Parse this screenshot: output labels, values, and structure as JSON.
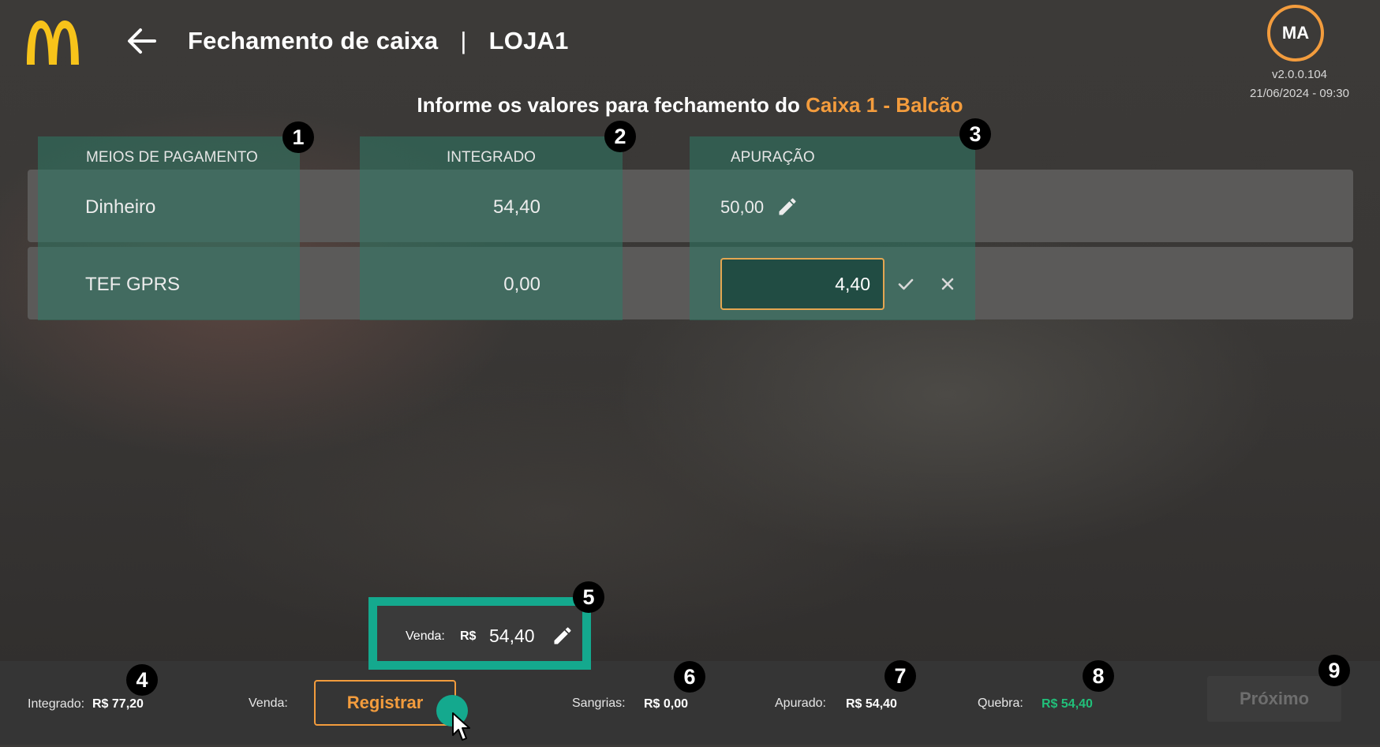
{
  "header": {
    "title": "Fechamento de caixa",
    "separator": "|",
    "store": "LOJA1",
    "user_initials": "MA",
    "version": "v2.0.0.104",
    "datetime": "21/06/2024 - 09:30"
  },
  "subtitle": {
    "prefix": "Informe os valores para fechamento do",
    "register_name": "Caixa 1 - Balcão"
  },
  "table": {
    "columns": [
      "MEIOS DE PAGAMENTO",
      "INTEGRADO",
      "APURAÇÃO"
    ],
    "rows": [
      {
        "method": "Dinheiro",
        "integrated": "54,40",
        "apuracao": "50,00"
      },
      {
        "method": "TEF GPRS",
        "integrated": "0,00",
        "apuracao": "4,40"
      }
    ]
  },
  "venda_popup": {
    "label": "Venda:",
    "currency": "R$",
    "value": "54,40"
  },
  "footer": {
    "integrado_label": "Integrado:",
    "integrado_value": "R$ 77,20",
    "venda_label": "Venda:",
    "register_button": "Registrar",
    "sangrias_label": "Sangrias:",
    "sangrias_value": "R$ 0,00",
    "apurado_label": "Apurado:",
    "apurado_value": "R$ 54,40",
    "quebra_label": "Quebra:",
    "quebra_value": "R$ 54,40",
    "next_button": "Próximo"
  },
  "badges": [
    "1",
    "2",
    "3",
    "4",
    "5",
    "6",
    "7",
    "8",
    "9"
  ],
  "colors": {
    "accent": "#f39c3d",
    "highlight": "#2e7a66",
    "popup_border": "#14a98e",
    "positive": "#21c07a",
    "logo": "#f7c31a"
  },
  "icons": [
    "mcdonalds-logo",
    "back-arrow-icon",
    "pencil-icon",
    "check-icon",
    "close-icon",
    "cursor-pointer-icon"
  ]
}
